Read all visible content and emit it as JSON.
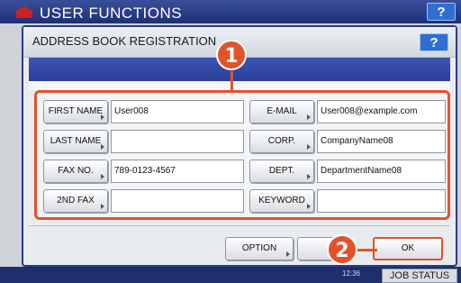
{
  "background": {
    "title": "USER FUNCTIONS",
    "help_label": "?",
    "clock": "12:36",
    "job_status_label": "JOB STATUS"
  },
  "dialog": {
    "title": "ADDRESS BOOK REGISTRATION",
    "help_label": "?"
  },
  "fields": {
    "first_name": {
      "label": "FIRST NAME",
      "value": "User008"
    },
    "last_name": {
      "label": "LAST NAME",
      "value": ""
    },
    "fax_no": {
      "label": "FAX NO.",
      "value": "789-0123-4567"
    },
    "fax2": {
      "label": "2ND FAX",
      "value": ""
    },
    "email": {
      "label": "E-MAIL",
      "value": "User008@example.com"
    },
    "corp": {
      "label": "CORP.",
      "value": "CompanyName08"
    },
    "dept": {
      "label": "DEPT.",
      "value": "DepartmentName08"
    },
    "keyword": {
      "label": "KEYWORD",
      "value": ""
    }
  },
  "buttons": {
    "option_label": "OPTION",
    "ok_label": "OK"
  },
  "callouts": {
    "one": "1",
    "two": "2"
  },
  "colors": {
    "accent": "#e2532a",
    "header_blue": "#2b3f96"
  }
}
